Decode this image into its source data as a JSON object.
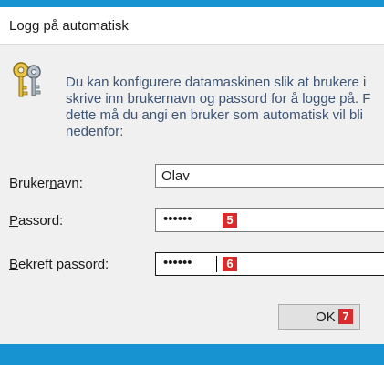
{
  "window": {
    "title": "Logg på automatisk"
  },
  "intro_lines": [
    "Du kan konfigurere datamaskinen slik at brukere i",
    "skrive inn brukernavn og passord for å logge på. F",
    "dette må du angi en bruker som automatisk vil bli",
    "nedenfor:"
  ],
  "form": {
    "username": {
      "label_before": "Bruker",
      "label_accel": "n",
      "label_after": "avn:",
      "value": "Olav"
    },
    "password": {
      "label_accel": "P",
      "label_after": "assord:",
      "value": "••••••",
      "badge": "5"
    },
    "confirm": {
      "label_accel": "B",
      "label_after": "ekreft passord:",
      "value": "••••••",
      "badge": "6"
    }
  },
  "ok_button": {
    "label": "OK",
    "badge": "7"
  },
  "colors": {
    "accent_blue": "#1793d1",
    "badge_red": "#d92b2b",
    "intro_text": "#3d5475"
  },
  "icons": [
    "keys-icon"
  ]
}
